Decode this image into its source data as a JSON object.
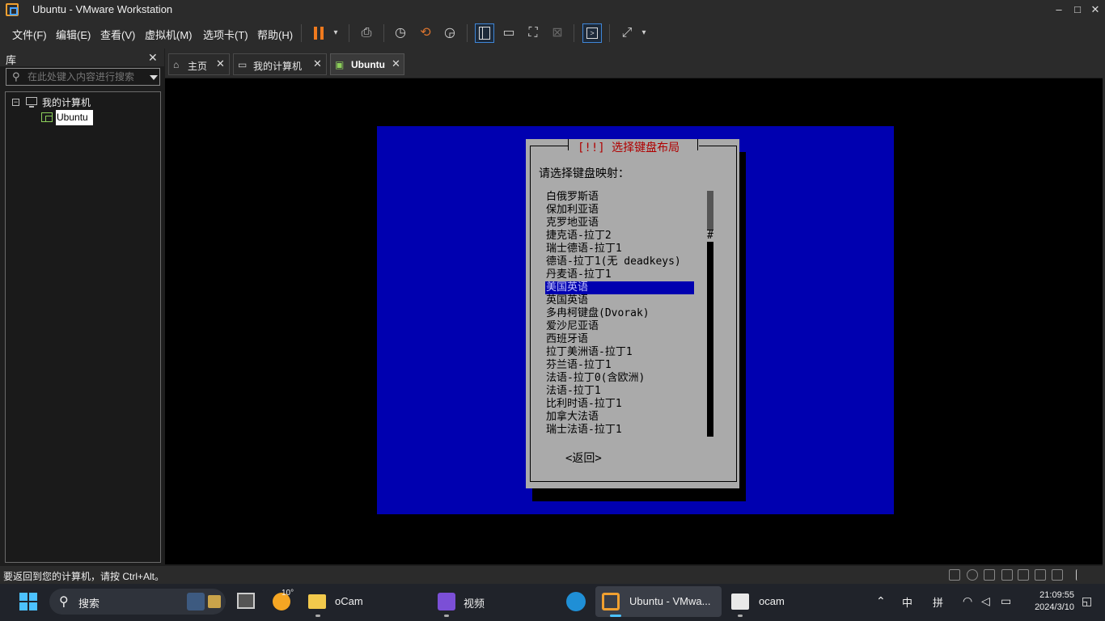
{
  "window": {
    "title": "Ubuntu - VMware Workstation",
    "min": "–",
    "max": "□",
    "close": "✕"
  },
  "menu": [
    "文件(F)",
    "编辑(E)",
    "查看(V)",
    "虚拟机(M)",
    "选项卡(T)",
    "帮助(H)"
  ],
  "library": {
    "title": "库",
    "close": "✕",
    "search_placeholder": "在此处键入内容进行搜索",
    "tree_root": "我的计算机",
    "tree_child": "Ubuntu",
    "toggle": "−"
  },
  "tabs": [
    {
      "label": "主页",
      "close": "✕"
    },
    {
      "label": "我的计算机",
      "close": "✕"
    },
    {
      "label": "Ubuntu",
      "close": "✕"
    }
  ],
  "installer": {
    "title": "[!!] 选择键盘布局",
    "prompt": "请选择键盘映射：",
    "items": [
      "白俄罗斯语",
      "保加利亚语",
      "克罗地亚语",
      "捷克语-拉丁2",
      "瑞士德语-拉丁1",
      "德语-拉丁1(无 deadkeys)",
      "丹麦语-拉丁1",
      "美国英语",
      "英国英语",
      "多冉柯键盘(Dvorak)",
      "爱沙尼亚语",
      "西班牙语",
      "拉丁美洲语-拉丁1",
      "芬兰语-拉丁1",
      "法语-拉丁0(含欧洲)",
      "法语-拉丁1",
      "比利时语-拉丁1",
      "加拿大法语",
      "瑞士法语-拉丁1"
    ],
    "selected_index": 7,
    "scroll_marker": "#",
    "back_button": "<返回>"
  },
  "status": {
    "text": "要返回到您的计算机，请按 Ctrl+Alt。"
  },
  "taskbar": {
    "search_label": "搜索",
    "weather": "10°",
    "apps": [
      "oCam",
      "视频",
      "Ubuntu - VMwa...",
      "ocam"
    ],
    "ime_lang": "中",
    "ime_mode": "拼",
    "time": "21:09:55",
    "date": "2024/3/10"
  },
  "colors": {
    "installer_blue": "#0000b0",
    "dialog_gray": "#aaaaaa",
    "title_red": "#b00000",
    "pause_orange": "#f07a1e",
    "accent_blue": "#4cc2ff"
  }
}
